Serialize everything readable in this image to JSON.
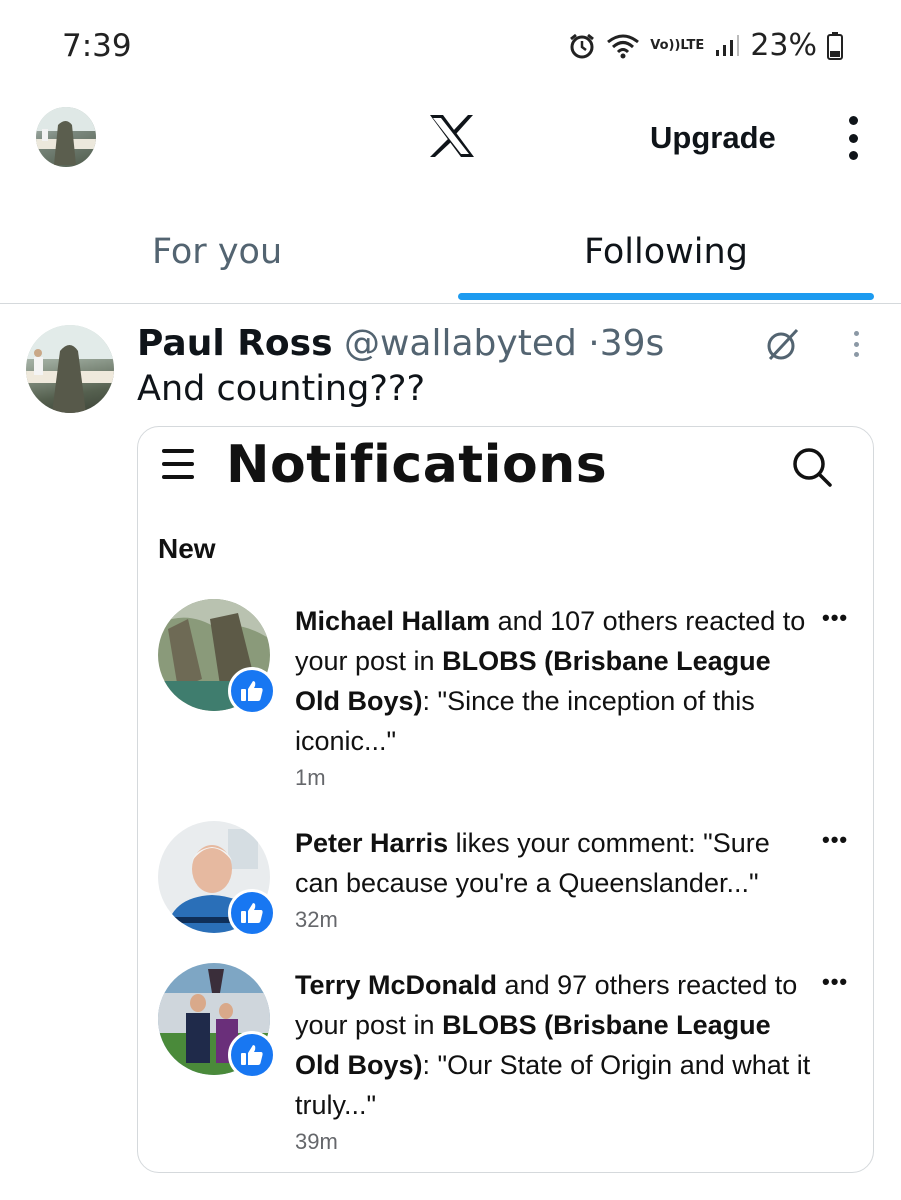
{
  "status_bar": {
    "time": "7:39",
    "network_label_top": "Vo))",
    "network_label_bottom": "LTE",
    "battery": "23%"
  },
  "header": {
    "logo": "X",
    "upgrade_label": "Upgrade"
  },
  "tabs": [
    {
      "label": "For you",
      "active": false
    },
    {
      "label": "Following",
      "active": true
    }
  ],
  "tweet": {
    "name": "Paul Ross",
    "handle": "@wallabyted",
    "separator": "·",
    "time": "39s",
    "text": "And counting???"
  },
  "screenshot": {
    "title": "Notifications",
    "section": "New",
    "items": [
      {
        "actor": "Michael Hallam",
        "pre": " and 107 others reacted to your post in ",
        "group": "BLOBS (Brisbane League Old Boys)",
        "post": ": \"Since the inception of this iconic...\"",
        "time": "1m",
        "more": "•••"
      },
      {
        "actor": "Peter Harris",
        "pre": " likes your comment: \"Sure can because you're a Queenslander...\"",
        "group": "",
        "post": "",
        "time": "32m",
        "more": "•••"
      },
      {
        "actor": "Terry McDonald",
        "pre": " and 97 others reacted to your post in ",
        "group": "BLOBS (Brisbane League Old Boys)",
        "post": ": \"Our State of Origin and what it truly...\"",
        "time": "39m",
        "more": "•••"
      }
    ]
  },
  "colors": {
    "accent": "#1d9bf0",
    "like_badge": "#1877f2",
    "secondary_text": "#536471"
  }
}
